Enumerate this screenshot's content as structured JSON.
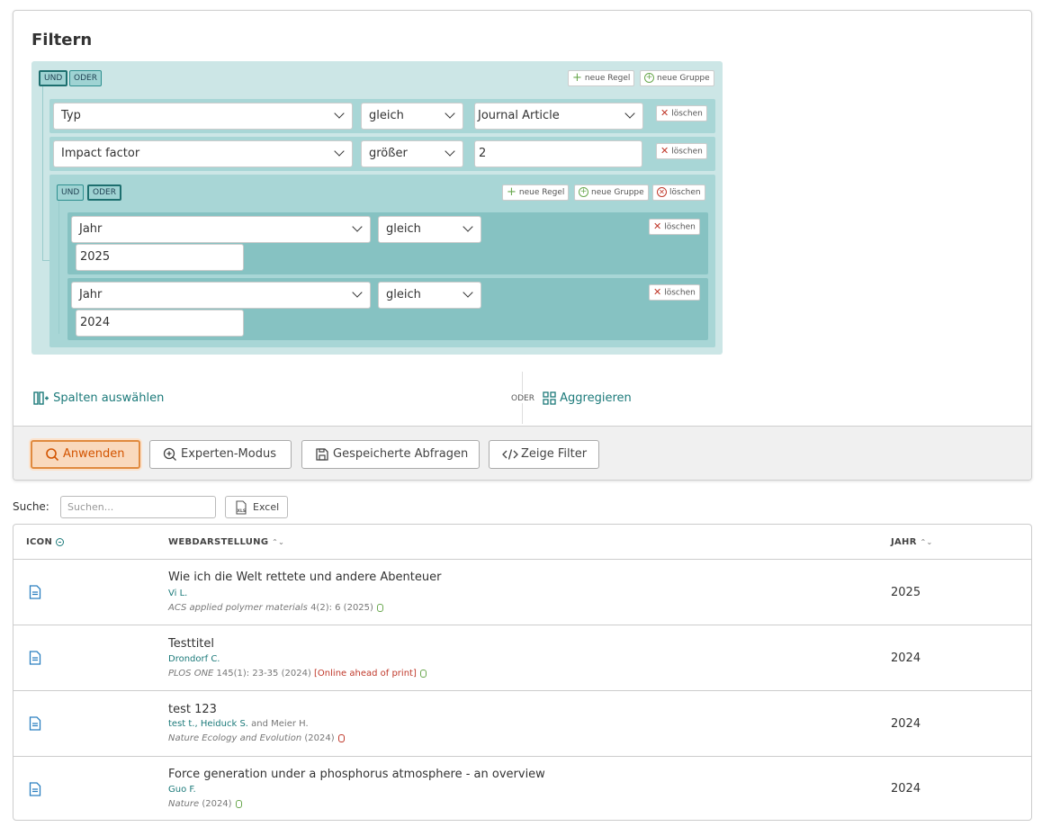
{
  "filter": {
    "title": "Filtern",
    "und": "UND",
    "oder": "ODER",
    "new_rule": "neue Regel",
    "new_group": "neue Gruppe",
    "delete": "löschen",
    "rules": [
      {
        "field": "Typ",
        "op": "gleich",
        "value": "Journal Article"
      },
      {
        "field": "Impact factor",
        "op": "größer",
        "value": "2"
      }
    ],
    "group_rules": [
      {
        "field": "Jahr",
        "op": "gleich",
        "value": "2025"
      },
      {
        "field": "Jahr",
        "op": "gleich",
        "value": "2024"
      }
    ],
    "columns_link": "Spalten auswählen",
    "or_label": "ODER",
    "aggregate_link": "Aggregieren"
  },
  "actions": {
    "apply": "Anwenden",
    "expert": "Experten-Modus",
    "saved": "Gespeicherte Abfragen",
    "show_filter": "Zeige Filter"
  },
  "search": {
    "label": "Suche:",
    "placeholder": "Suchen...",
    "excel": "Excel"
  },
  "table": {
    "headers": {
      "icon": "ICON",
      "web": "WEBDARSTELLUNG",
      "year": "JAHR"
    },
    "rows": [
      {
        "title": "Wie ich die Welt rettete und andere Abenteuer",
        "authors": "Vi L.",
        "journal": "ACS applied polymer materials",
        "details": " 4(2): 6 (2025)",
        "note": "",
        "year": "2025"
      },
      {
        "title": "Testtitel",
        "authors": "Drondorf C.",
        "journal": "PLOS ONE",
        "details": " 145(1): 23-35 (2024) ",
        "note": "[Online ahead of print]",
        "year": "2024"
      },
      {
        "title": "test 123",
        "authors": "test t., Heiduck S.",
        "authors_extra": " and Meier H.",
        "journal": "Nature Ecology and Evolution",
        "details": " (2024)",
        "note": "",
        "year": "2024"
      },
      {
        "title": "Force generation under a phosphorus atmosphere - an overview",
        "authors": "Guo F.",
        "journal": "Nature",
        "details": " (2024)",
        "note": "",
        "year": "2024"
      }
    ]
  },
  "colors": {
    "accent": "#1c7a7a",
    "primary_button": "#f9d9bd",
    "primary_border": "#e08a3f"
  },
  "icons": [
    "plus-icon",
    "add-group-icon",
    "delete-icon",
    "chevron-down-icon",
    "columns-icon",
    "grid-icon",
    "search-icon",
    "zoom-in-icon",
    "save-icon",
    "code-icon",
    "excel-icon",
    "document-icon",
    "open-access-icon",
    "sort-icon"
  ]
}
